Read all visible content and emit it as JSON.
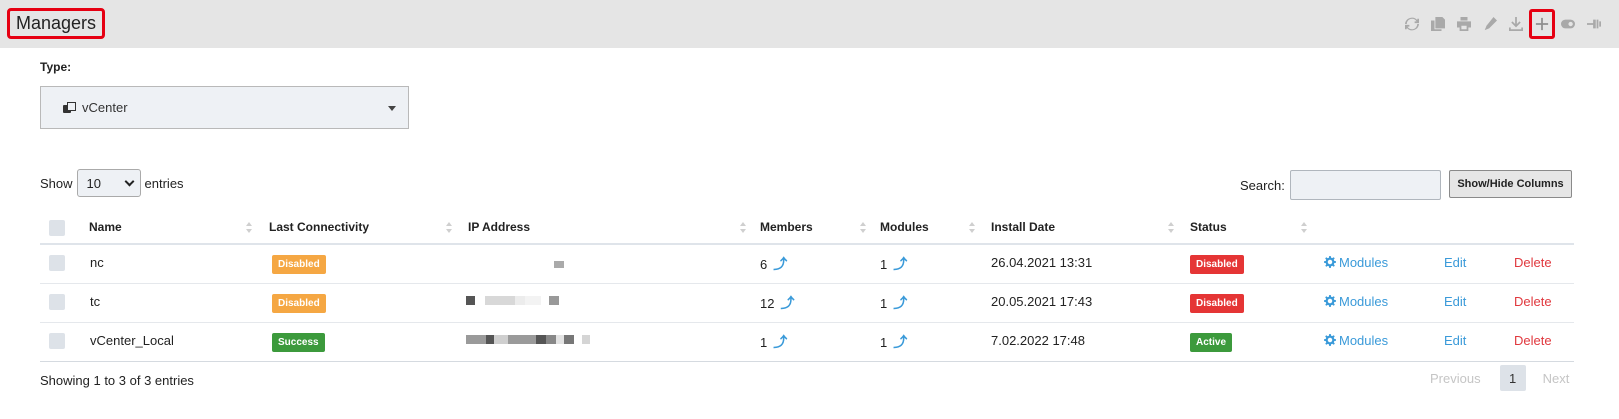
{
  "header": {
    "title": "Managers",
    "toolbar": [
      "refresh-icon",
      "copy-icon",
      "print-icon",
      "edit-icon",
      "download-icon",
      "plus-icon",
      "toggle-icon",
      "pin-icon"
    ]
  },
  "type_filter": {
    "label": "Type:",
    "value": "vCenter"
  },
  "length": {
    "prefix": "Show",
    "value": "10",
    "suffix": "entries"
  },
  "search": {
    "label": "Search:",
    "value": ""
  },
  "show_hide_label": "Show/Hide Columns",
  "table": {
    "columns": [
      "Name",
      "Last Connectivity",
      "IP Address",
      "Members",
      "Modules",
      "Install Date",
      "Status"
    ],
    "rows": [
      {
        "name": "nc",
        "connectivity": "Disabled",
        "members": "6",
        "modules": "1",
        "install_date": "26.04.2021 13:31",
        "status": "Disabled",
        "modules_link": "Modules",
        "edit": "Edit",
        "delete": "Delete"
      },
      {
        "name": "tc",
        "connectivity": "Disabled",
        "members": "12",
        "modules": "1",
        "install_date": "20.05.2021 17:43",
        "status": "Disabled",
        "modules_link": "Modules",
        "edit": "Edit",
        "delete": "Delete"
      },
      {
        "name": "vCenter_Local",
        "connectivity": "Success",
        "members": "1",
        "modules": "1",
        "install_date": "7.02.2022 17:48",
        "status": "Active",
        "modules_link": "Modules",
        "edit": "Edit",
        "delete": "Delete"
      }
    ]
  },
  "footer": {
    "info": "Showing 1 to 3 of 3 entries",
    "previous": "Previous",
    "page": "1",
    "next": "Next"
  },
  "colors": {
    "header_bg": "#e5e5e5",
    "highlight": "#e60012",
    "badge_orange": "#f5a743",
    "badge_red": "#e53535",
    "badge_green": "#3c9a3c",
    "link_blue": "#3a9ad9",
    "delete_red": "#e0383e"
  }
}
